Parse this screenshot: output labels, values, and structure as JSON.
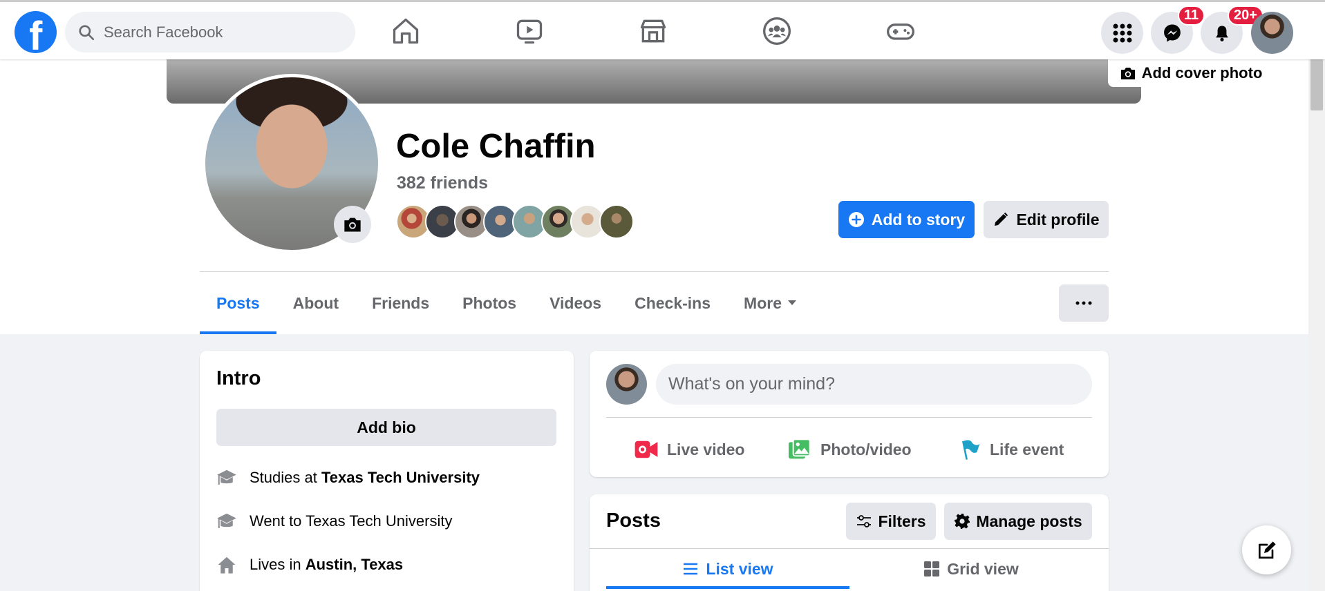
{
  "header": {
    "search_placeholder": "Search Facebook",
    "messenger_badge": "11",
    "notifications_badge": "20+"
  },
  "profile": {
    "add_cover_photo": "Add cover photo",
    "name": "Cole Chaffin",
    "friends_count": "382 friends",
    "add_to_story": "Add to story",
    "edit_profile": "Edit profile"
  },
  "tabs": [
    "Posts",
    "About",
    "Friends",
    "Photos",
    "Videos",
    "Check-ins",
    "More"
  ],
  "intro": {
    "title": "Intro",
    "add_bio": "Add bio",
    "studies_prefix": "Studies at ",
    "studies_school": "Texas Tech University",
    "went_to": "Went to Texas Tech University",
    "lives_prefix": "Lives in ",
    "lives_city": "Austin, Texas"
  },
  "composer": {
    "placeholder": "What's on your mind?",
    "live_video": "Live video",
    "photo_video": "Photo/video",
    "life_event": "Life event"
  },
  "posts": {
    "title": "Posts",
    "filters": "Filters",
    "manage_posts": "Manage posts",
    "list_view": "List view",
    "grid_view": "Grid view"
  },
  "colors": {
    "brand": "#1877f2",
    "badge": "#e41e3f",
    "live": "#f02849",
    "photo": "#45bd62",
    "life_event": "#1fa2c8"
  }
}
